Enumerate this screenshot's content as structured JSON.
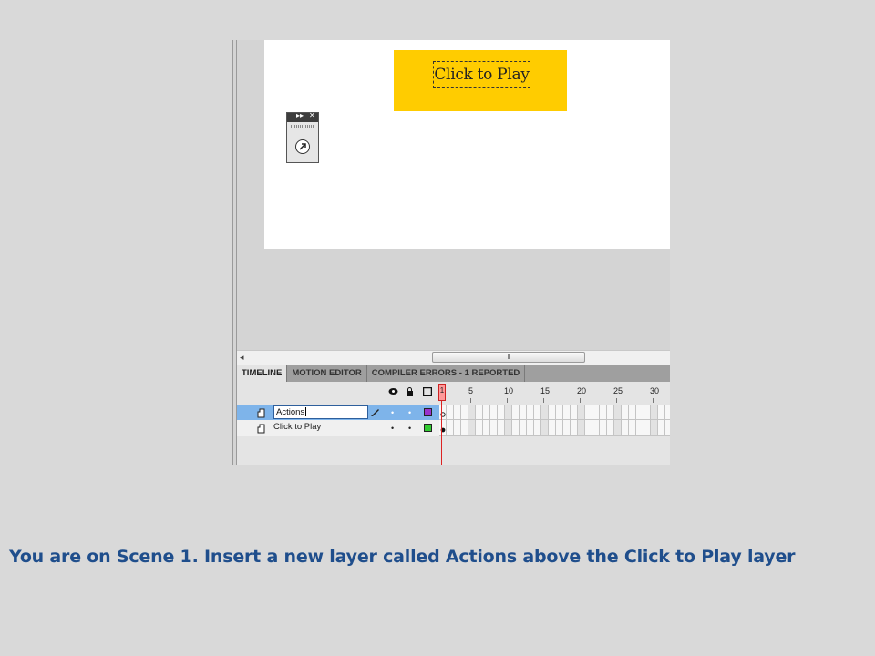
{
  "stage": {
    "button_text": "Click to Play",
    "button_color": "#ffcc00"
  },
  "scrollbar": {
    "left_arrow": "◂",
    "thumb_grip": "III"
  },
  "tabs": [
    {
      "label": "TIMELINE",
      "active": true
    },
    {
      "label": "MOTION EDITOR",
      "active": false
    },
    {
      "label": "COMPILER ERRORS - 1 REPORTED",
      "active": false
    }
  ],
  "timeline": {
    "header_icons": [
      "eye-icon",
      "lock-icon",
      "outline-icon"
    ],
    "frame_numbers": [
      "1",
      "5",
      "10",
      "15",
      "20",
      "25",
      "30"
    ],
    "current_frame": "1",
    "layers": [
      {
        "name": "Actions",
        "selected": true,
        "editing": true,
        "outline_color": "#9933cc"
      },
      {
        "name": "Click to Play",
        "selected": false,
        "editing": false,
        "outline_color": "#33cc33"
      }
    ],
    "selected_row_color": "#7eb4ea"
  },
  "caption": "You are on Scene 1. Insert a new layer called Actions above the Click to Play layer"
}
